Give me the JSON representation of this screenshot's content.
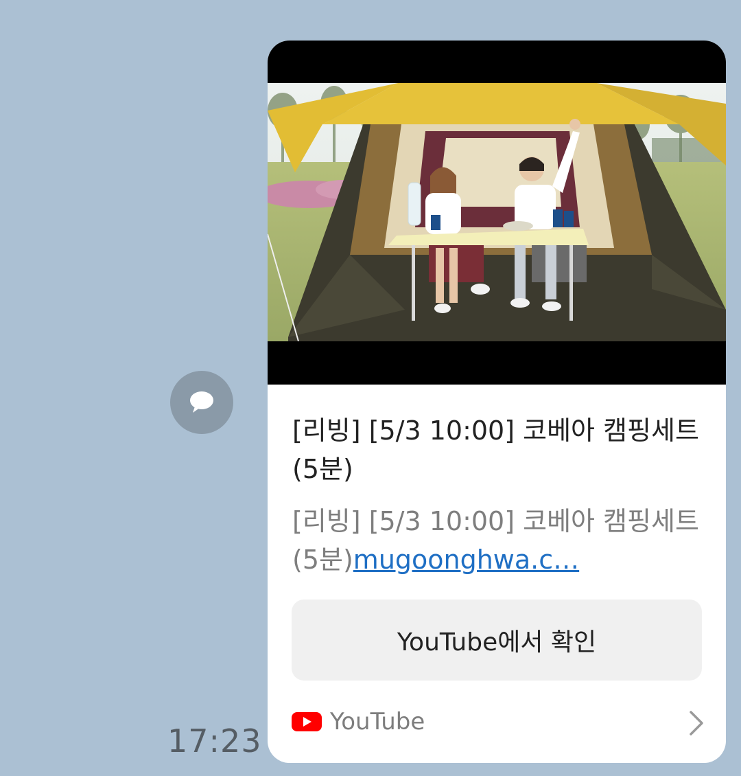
{
  "message": {
    "timestamp": "17:23"
  },
  "link_card": {
    "title": "[리빙] [5/3 10:00] 코베아 캠핑세트(5분)",
    "description_text": "[리빙] [5/3 10:00] 코베아 캠핑세트(5분)",
    "description_link": "mugoonghwa.c…",
    "action_button_label": "YouTube에서 확인",
    "source_name": "YouTube",
    "icons": {
      "share": "speech-bubble-icon",
      "source": "youtube-logo-icon",
      "more": "chevron-right-icon"
    }
  },
  "colors": {
    "chat_background": "#abc0d3",
    "card_background": "#ffffff",
    "link": "#1f6fc4",
    "youtube_red": "#ff0000"
  }
}
